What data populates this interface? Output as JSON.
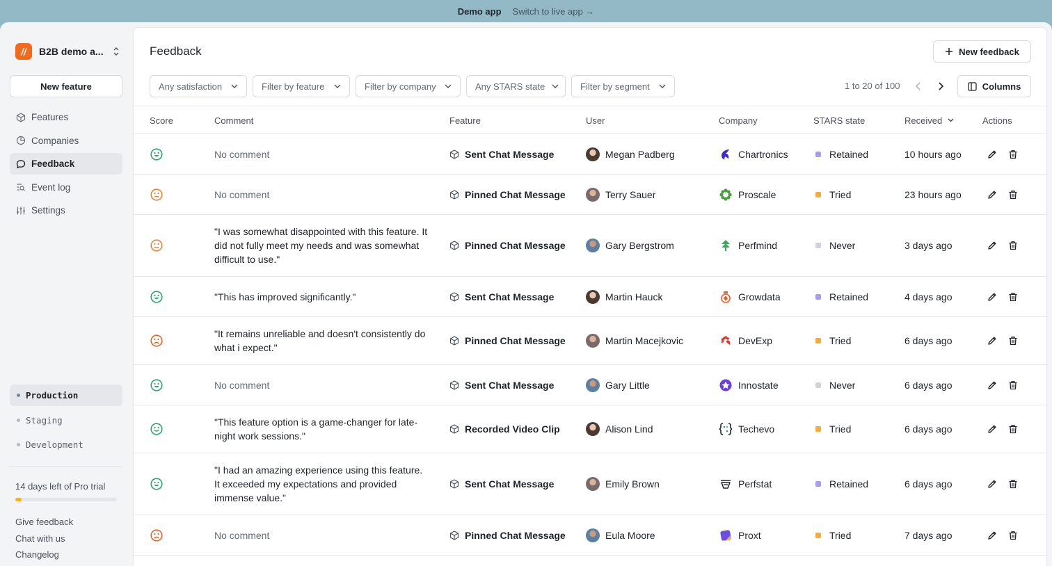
{
  "topbar": {
    "demo_label": "Demo app",
    "switch_label": "Switch to live app →"
  },
  "sidebar": {
    "org_name": "B2B demo a...",
    "new_feature_label": "New feature",
    "nav": [
      {
        "label": "Features",
        "icon": "cube-icon"
      },
      {
        "label": "Companies",
        "icon": "pie-chart-icon"
      },
      {
        "label": "Feedback",
        "icon": "chat-bubble-icon",
        "active": true
      },
      {
        "label": "Event log",
        "icon": "event-log-icon"
      },
      {
        "label": "Settings",
        "icon": "sliders-icon"
      }
    ],
    "environments": [
      {
        "label": "Production",
        "active": true
      },
      {
        "label": "Staging"
      },
      {
        "label": "Development"
      }
    ],
    "trial": {
      "label": "14 days left of Pro trial",
      "progress": 0.06
    },
    "footer_links": [
      "Give feedback",
      "Chat with us",
      "Changelog"
    ]
  },
  "main": {
    "title": "Feedback",
    "new_feedback_label": "New feedback",
    "columns_label": "Columns",
    "filters": [
      "Any satisfaction",
      "Filter by feature",
      "Filter by company",
      "Any STARS state",
      "Filter by segment"
    ],
    "pagination": "1 to 20 of 100",
    "headers": {
      "score": "Score",
      "comment": "Comment",
      "feature": "Feature",
      "user": "User",
      "company": "Company",
      "stars": "STARS state",
      "received": "Received",
      "actions": "Actions"
    }
  },
  "colors": {
    "happy": "#2fa56b",
    "neutral": "#e8833a",
    "sad": "#e0662c",
    "retained": "#a69cf0",
    "tried": "#f4ad3d",
    "never": "#d0d3d8"
  },
  "rows": [
    {
      "score": "very-happy",
      "comment": "No comment",
      "no_comment": true,
      "feature": "Sent Chat Message",
      "user": "Megan Padberg",
      "company": "Chartronics",
      "company_icon": "chartronics-logo",
      "stars": "Retained",
      "received": "10 hours ago"
    },
    {
      "score": "neutral",
      "comment": "No comment",
      "no_comment": true,
      "feature": "Pinned Chat Message",
      "user": "Terry Sauer",
      "company": "Proscale",
      "company_icon": "proscale-logo",
      "stars": "Tried",
      "received": "23 hours ago"
    },
    {
      "score": "neutral",
      "comment": "\"I was somewhat disappointed with this feature. It did not fully meet my needs and was somewhat difficult to use.\"",
      "feature": "Pinned Chat Message",
      "user": "Gary Bergstrom",
      "company": "Perfmind",
      "company_icon": "perfmind-logo",
      "stars": "Never",
      "received": "3 days ago"
    },
    {
      "score": "very-happy",
      "comment": "\"This has improved significantly.\"",
      "feature": "Sent Chat Message",
      "user": "Martin Hauck",
      "company": "Growdata",
      "company_icon": "growdata-logo",
      "stars": "Retained",
      "received": "4 days ago"
    },
    {
      "score": "sad",
      "comment": "\"It remains unreliable and doesn't consistently do what i expect.\"",
      "feature": "Pinned Chat Message",
      "user": "Martin Macejkovic",
      "company": "DevExp",
      "company_icon": "devexp-logo",
      "stars": "Tried",
      "received": "6 days ago"
    },
    {
      "score": "very-happy",
      "comment": "No comment",
      "no_comment": true,
      "feature": "Sent Chat Message",
      "user": "Gary Little",
      "company": "Innostate",
      "company_icon": "innostate-logo",
      "stars": "Never",
      "received": "6 days ago"
    },
    {
      "score": "happy",
      "comment": "\"This feature option is a game-changer for late-night work sessions.\"",
      "feature": "Recorded Video Clip",
      "user": "Alison Lind",
      "company": "Techevo",
      "company_icon": "techevo-logo",
      "stars": "Tried",
      "received": "6 days ago"
    },
    {
      "score": "very-happy",
      "comment": "\"I had an amazing experience using this feature. It exceeded my expectations and provided immense value.\"",
      "feature": "Sent Chat Message",
      "user": "Emily Brown",
      "company": "Perfstat",
      "company_icon": "perfstat-logo",
      "stars": "Retained",
      "received": "6 days ago"
    },
    {
      "score": "sad",
      "comment": "No comment",
      "no_comment": true,
      "feature": "Pinned Chat Message",
      "user": "Eula Moore",
      "company": "Proxt",
      "company_icon": "proxt-logo",
      "stars": "Tried",
      "received": "7 days ago"
    }
  ]
}
